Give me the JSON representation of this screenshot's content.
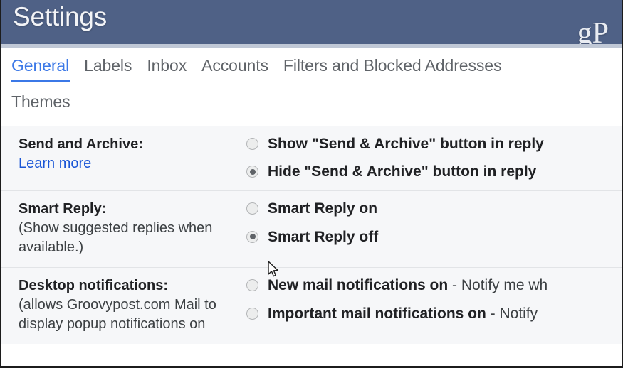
{
  "window": {
    "title": "Settings",
    "watermark": "gP"
  },
  "tabs": {
    "row1": [
      {
        "label": "General",
        "active": true
      },
      {
        "label": "Labels",
        "active": false
      },
      {
        "label": "Inbox",
        "active": false
      },
      {
        "label": "Accounts",
        "active": false
      },
      {
        "label": "Filters and Blocked Addresses",
        "active": false
      }
    ],
    "row2": [
      {
        "label": "Themes",
        "active": false
      }
    ]
  },
  "settings": [
    {
      "title": "Send and Archive:",
      "link": "Learn more",
      "sub": "",
      "options": [
        {
          "strong": "Show \"Send & Archive\" button in reply",
          "rest": "",
          "checked": false
        },
        {
          "strong": "Hide \"Send & Archive\" button in reply",
          "rest": "",
          "checked": true
        }
      ]
    },
    {
      "title": "Smart Reply:",
      "link": "",
      "sub": "(Show suggested replies when available.)",
      "options": [
        {
          "strong": "Smart Reply on",
          "rest": "",
          "checked": false
        },
        {
          "strong": "Smart Reply off",
          "rest": "",
          "checked": true
        }
      ]
    },
    {
      "title": "Desktop notifications:",
      "link": "",
      "sub": "(allows Groovypost.com Mail to display popup notifications on",
      "options": [
        {
          "strong": "New mail notifications on",
          "rest": " - Notify me wh",
          "checked": false
        },
        {
          "strong": "Important mail notifications on",
          "rest": " - Notify ",
          "checked": false
        }
      ]
    }
  ],
  "colors": {
    "titlebar": "#4f6186",
    "accent": "#3b78e7",
    "link": "#1a56d6",
    "tab_text": "#5f6368",
    "row_background": "#f6f7f9"
  },
  "cursor": {
    "name": "arrow-pointer"
  }
}
